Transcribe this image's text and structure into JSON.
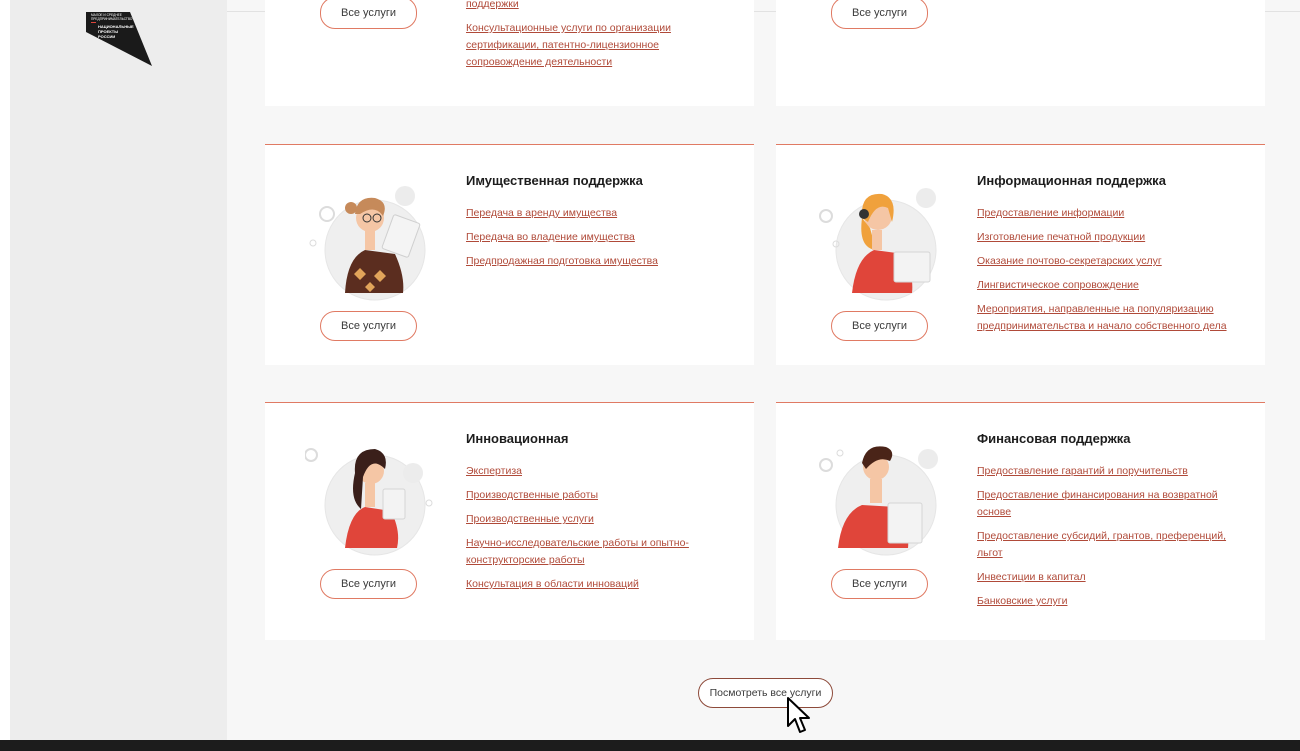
{
  "logo": {
    "lines": [
      "МАЛОЕ И СРЕДНЕЕ",
      "ПРЕДПРИНИМАТЕЛЬСТВО",
      "НАЦИОНАЛЬНЫЕ",
      "ПРОЕКТЫ",
      "РОССИИ"
    ]
  },
  "cards": {
    "top_left": {
      "button": "Все услуги",
      "links": [
        "поддержки",
        "Консультационные услуги по организации сертификации, патентно-лицензионное сопровождение деятельности"
      ]
    },
    "top_right": {
      "button": "Все услуги"
    },
    "property": {
      "title": "Имущественная поддержка",
      "button": "Все услуги",
      "links": [
        "Передача в аренду имущества",
        "Передача во владение имущества",
        "Предпродажная подготовка имущества"
      ]
    },
    "info": {
      "title": "Информационная поддержка",
      "button": "Все услуги",
      "links": [
        "Предоставление информации",
        "Изготовление печатной продукции",
        "Оказание почтово-секретарских услуг",
        "Лингвистическое сопровождение",
        "Мероприятия, направленные на популяризацию предпринимательства и начало собственного дела"
      ]
    },
    "innovation": {
      "title": "Инновационная",
      "button": "Все услуги",
      "links": [
        "Экспертиза",
        "Производственные работы",
        "Производственные услуги",
        "Научно-исследовательские работы и опытно-конструкторские работы",
        "Консультация в области инноваций"
      ]
    },
    "finance": {
      "title": "Финансовая поддержка",
      "button": "Все услуги",
      "links": [
        "Предоставление гарантий и поручительств",
        "Предоставление финансирования на возвратной основе",
        "Предоставление субсидий, грантов, преференций, льгот",
        "Инвестиции в капитал",
        "Банковские услуги"
      ]
    }
  },
  "see_all_button": "Посмотреть все услуги",
  "colors": {
    "accent": "#e07a63",
    "link": "#b04a39",
    "sidebar": "#ededed",
    "main_bg": "#f7f7f7",
    "footer": "#1c1c1c"
  }
}
